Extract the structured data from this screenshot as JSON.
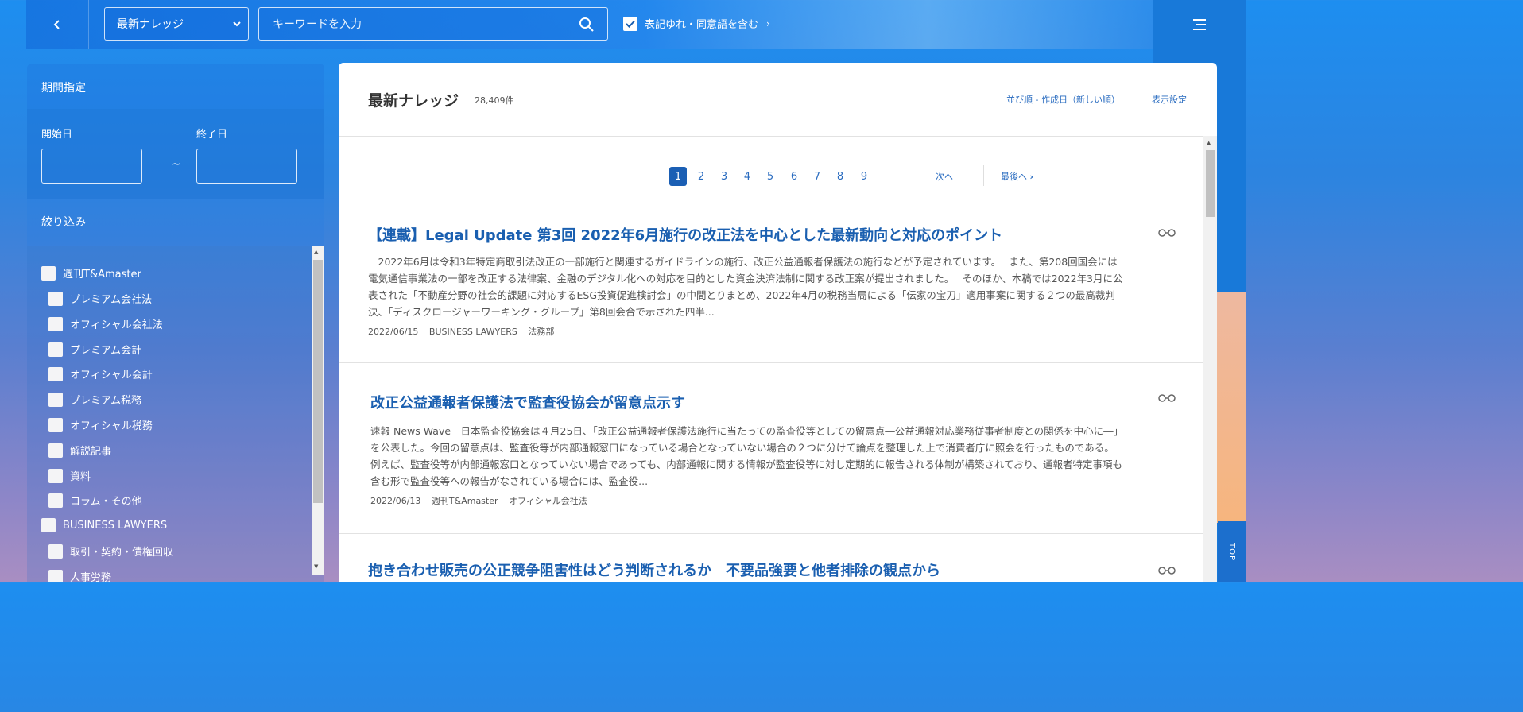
{
  "header": {
    "select_value": "最新ナレッジ",
    "search_placeholder": "キーワードを入力",
    "synonym_label": "表記ゆれ・同意語を含む",
    "synonym_checked": true
  },
  "sidebar": {
    "period_title": "期間指定",
    "start_label": "開始日",
    "end_label": "終了日",
    "tilde": "~",
    "filter_title": "絞り込み",
    "items": [
      {
        "label": "週刊T&Amaster",
        "level": 0
      },
      {
        "label": "プレミアム会社法",
        "level": 1
      },
      {
        "label": "オフィシャル会社法",
        "level": 1
      },
      {
        "label": "プレミアム会計",
        "level": 1
      },
      {
        "label": "オフィシャル会計",
        "level": 1
      },
      {
        "label": "プレミアム税務",
        "level": 1
      },
      {
        "label": "オフィシャル税務",
        "level": 1
      },
      {
        "label": "解説記事",
        "level": 1
      },
      {
        "label": "資料",
        "level": 1
      },
      {
        "label": "コラム・その他",
        "level": 1
      },
      {
        "label": "BUSINESS LAWYERS",
        "level": 0
      },
      {
        "label": "取引・契約・債権回収",
        "level": 1
      },
      {
        "label": "人事労務",
        "level": 1
      }
    ]
  },
  "main": {
    "title": "最新ナレッジ",
    "count": "28,409件",
    "sort_label": "並び順 - 作成日（新しい順）",
    "display_settings": "表示設定",
    "pagination": {
      "pages": [
        "1",
        "2",
        "3",
        "4",
        "5",
        "6",
        "7",
        "8",
        "9"
      ],
      "current": "1",
      "next": "次へ",
      "last": "最後へ"
    },
    "articles": [
      {
        "title": "【連載】Legal Update 第3回 2022年6月施行の改正法を中心とした最新動向と対応のポイント",
        "body": "　2022年6月は令和3年特定商取引法改正の一部施行と関連するガイドラインの施行、改正公益通報者保護法の施行などが予定されています。　 また、第208回国会には電気通信事業法の一部を改正する法律案、金融のデジタル化への対応を目的とした資金決済法制に関する改正案が提出されました。　 そのほか、本稿では2022年3月に公表された「不動産分野の社会的課題に対応するESG投資促進検討会」の中間とりまとめ、2022年4月の税務当局による「伝家の宝刀」適用事案に関する２つの最高裁判決、「ディスクロージャーワーキング・グループ」第8回会合で示された四半...",
        "date": "2022/06/15",
        "source": "BUSINESS LAWYERS",
        "category": "法務部"
      },
      {
        "title": "改正公益通報者保護法で監査役協会が留意点示す",
        "body": "速報 News Wave　日本監査役協会は４月25日、「改正公益通報者保護法施行に当たっての監査役等としての留意点―公益通報対応業務従事者制度との関係を中心に―」を公表した。今回の留意点は、監査役等が内部通報窓口になっている場合となっていない場合の２つに分けて論点を整理した上で消費者庁に照会を行ったものである。例えば、監査役等が内部通報窓口となっていない場合であっても、内部通報に関する情報が監査役等に対し定期的に報告される体制が構築されており、通報者特定事項も含む形で監査役等への報告がなされている場合には、監査役...",
        "date": "2022/06/13",
        "source": "週刊T&Amaster",
        "category": "オフィシャル会社法"
      },
      {
        "title": "抱き合わせ販売の公正競争阻害性はどう判断されるか　不要品強要と他者排除の観点から",
        "body": "",
        "date": "",
        "source": "",
        "category": ""
      }
    ]
  },
  "top_button": "TOP"
}
